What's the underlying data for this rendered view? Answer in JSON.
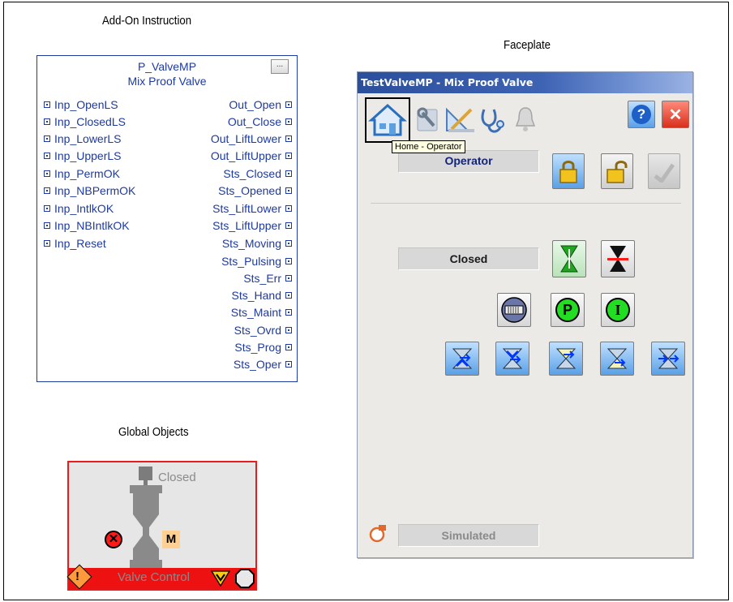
{
  "captions": {
    "aoi": "Add-On Instruction",
    "faceplate": "Faceplate",
    "global_objects": "Global Objects"
  },
  "aoi": {
    "name": "P_ValveMP",
    "description": "Mix Proof Valve",
    "properties_button": "...",
    "inputs": [
      "Inp_OpenLS",
      "Inp_ClosedLS",
      "Inp_LowerLS",
      "Inp_UpperLS",
      "Inp_PermOK",
      "Inp_NBPermOK",
      "Inp_IntlkOK",
      "Inp_NBIntlkOK",
      "Inp_Reset"
    ],
    "outputs": [
      "Out_Open",
      "Out_Close",
      "Out_LiftLower",
      "Out_LiftUpper",
      "Sts_Closed",
      "Sts_Opened",
      "Sts_LiftLower",
      "Sts_LiftUpper",
      "Sts_Moving",
      "Sts_Pulsing",
      "Sts_Err",
      "Sts_Hand",
      "Sts_Maint",
      "Sts_Ovrd",
      "Sts_Prog",
      "Sts_Oper"
    ]
  },
  "global_object": {
    "status_text": "Closed",
    "mode_badge": "M",
    "bar_label": "Valve Control"
  },
  "faceplate": {
    "title": "TestValveMP - Mix Proof Valve",
    "tooltip": "Home - Operator",
    "tabs": [
      "home-icon",
      "maintenance-icon",
      "engineering-icon",
      "diagnostics-icon",
      "alarm-bell-icon"
    ],
    "mode_label": "Operator",
    "state_label": "Closed",
    "sim_label": "Simulated",
    "help_label": "?",
    "close_label": "✕",
    "permissive_p": "P",
    "interlock_i": "I",
    "colors": {
      "title_bar": "#2b4f9b",
      "accent_blue": "#3b7dd8",
      "ok_green": "#22cc22",
      "alarm_red": "#ee1111"
    }
  }
}
